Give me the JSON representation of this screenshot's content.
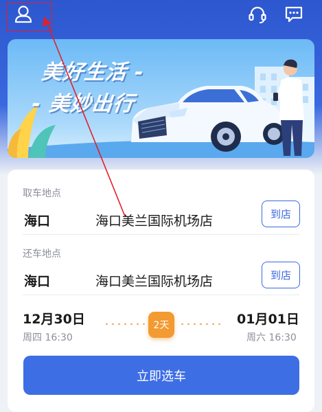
{
  "banner": {
    "slogan_line1": "美好生活 -",
    "slogan_line2": "- 美妙出行"
  },
  "pickup": {
    "label": "取车地点",
    "city": "海口",
    "store": "海口美兰国际机场店",
    "button": "到店"
  },
  "return": {
    "label": "还车地点",
    "city": "海口",
    "store": "海口美兰国际机场店",
    "button": "到店"
  },
  "dates": {
    "start_date": "12月30日",
    "start_time": "周四 16:30",
    "duration": "2天",
    "end_date": "01月01日",
    "end_time": "周六 16:30"
  },
  "action": {
    "select_car": "立即选车"
  },
  "icons": {
    "user": "user-icon",
    "support": "headset-icon",
    "chat": "chat-icon"
  },
  "colors": {
    "brand_blue": "#3d6ee4",
    "accent_orange": "#f39a32",
    "annotation_red": "#e0202a"
  }
}
